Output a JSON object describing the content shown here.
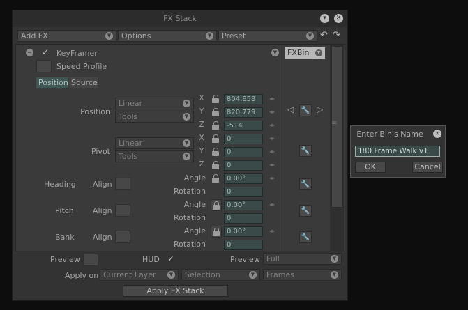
{
  "window": {
    "title": "FX Stack"
  },
  "toolbar": {
    "add_fx": "Add FX",
    "options": "Options",
    "preset": "Preset"
  },
  "layer": {
    "name": "KeyFramer",
    "speed_profile": "Speed Profile",
    "bin_button": "FXBin"
  },
  "tabs": {
    "position": "Position",
    "source": "Source"
  },
  "position": {
    "label": "Position",
    "interp": "Linear",
    "mode": "Tools",
    "x": "804.858",
    "y": "820.779",
    "z": "-514"
  },
  "pivot": {
    "label": "Pivot",
    "interp": "Linear",
    "mode": "Tools",
    "x": "0",
    "y": "0",
    "z": "0"
  },
  "axes": {
    "x": "X",
    "y": "Y",
    "z": "Z"
  },
  "rotations": [
    {
      "label": "Heading",
      "align": "Align",
      "angle_label": "Angle",
      "angle": "0.00°",
      "rotation_label": "Rotation",
      "rotation": "0"
    },
    {
      "label": "Pitch",
      "align": "Align",
      "angle_label": "Angle",
      "angle": "0.00°",
      "rotation_label": "Rotation",
      "rotation": "0"
    },
    {
      "label": "Bank",
      "align": "Align",
      "angle_label": "Angle",
      "angle": "0.00°",
      "rotation_label": "Rotation",
      "rotation": "0"
    }
  ],
  "bottom": {
    "preview_label": "Preview",
    "hud_label": "HUD",
    "preview2_label": "Preview",
    "preview_mode": "Full",
    "apply_on_label": "Apply on",
    "apply_target": "Current Layer",
    "apply_selection": "Selection",
    "apply_frames": "Frames",
    "apply_button": "Apply FX Stack"
  },
  "dialog": {
    "title": "Enter Bin's Name",
    "value": "180 Frame Walk v1",
    "ok": "OK",
    "cancel": "Cancel"
  }
}
